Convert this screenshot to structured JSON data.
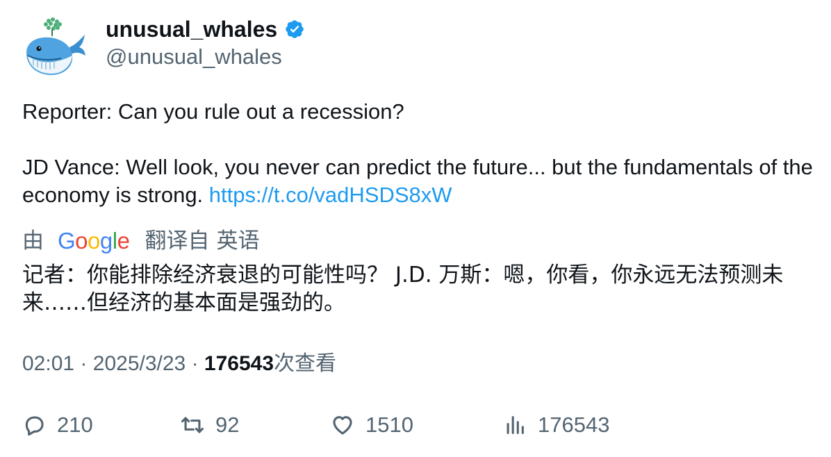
{
  "author": {
    "display_name": "unusual_whales",
    "handle": "@unusual_whales",
    "verified_color": "#1d9bf0",
    "avatar_icon": "whale-icon"
  },
  "tweet": {
    "line1": "Reporter: Can you rule out a recession?",
    "line2": "JD Vance: Well look, you never can predict the future... but the fundamentals of the economy is strong.",
    "link": "https://t.co/vadHSDS8xW"
  },
  "translation": {
    "by_label": "由",
    "provider": "Google",
    "from_label": "翻译自",
    "source_language": "英语",
    "text": "记者：你能排除经济衰退的可能性吗？ J.D. 万斯：嗯，你看，你永远无法预测未来……但经济的基本面是强劲的。"
  },
  "meta": {
    "time": "02:01",
    "separator": "·",
    "date": "2025/3/23",
    "views_count": "176543",
    "views_label": "次查看"
  },
  "actions": {
    "replies": "210",
    "retweets": "92",
    "likes": "1510",
    "views": "176543"
  },
  "colors": {
    "text": "#0f1419",
    "secondary": "#536471",
    "link": "#1d9bf0"
  }
}
